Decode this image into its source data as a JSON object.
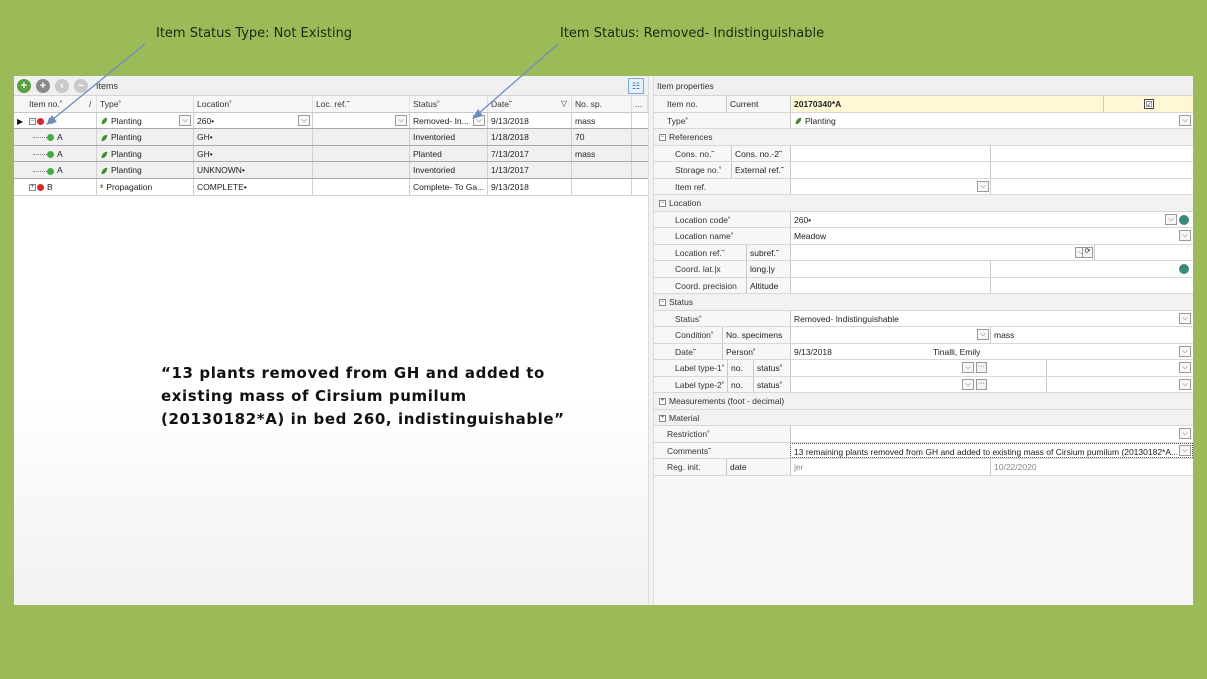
{
  "callouts": {
    "left": "Item Status Type: Not Existing",
    "right": "Item Status: Removed- Indistinguishable"
  },
  "quote": "“13 plants removed from GH and added to existing mass of Cirsium pumilum (20130182*A) in bed 260, indistinguishable”",
  "items_pane": {
    "title": "Items",
    "toolbar_icons": [
      "add-icon",
      "add-child-icon",
      "back-icon",
      "remove-icon",
      "tree-view-icon"
    ],
    "columns": [
      "Item no.˚",
      "Type˚",
      "Location˚",
      "Loc. ref.˜",
      "Status˚",
      "Date˜",
      "No. sp.",
      "..."
    ],
    "header_slash": "/",
    "rows": [
      {
        "no": "A",
        "type": "Planting",
        "location": "260•",
        "locref": "",
        "status": "Removed- In...",
        "date": "9/13/2018",
        "nsp": "mass"
      },
      {
        "no": "A",
        "type": "Planting",
        "location": "GH•",
        "locref": "",
        "status": "Inventoried",
        "date": "1/18/2018",
        "nsp": "70"
      },
      {
        "no": "A",
        "type": "Planting",
        "location": "GH•",
        "locref": "",
        "status": "Planted",
        "date": "7/13/2017",
        "nsp": "mass"
      },
      {
        "no": "A",
        "type": "Planting",
        "location": "UNKNOWN•",
        "locref": "",
        "status": "Inventoried",
        "date": "1/13/2017",
        "nsp": ""
      },
      {
        "no": "B",
        "type": "Propagation",
        "location": "COMPLETE•",
        "locref": "",
        "status": "Complete- To Ga...",
        "date": "9/13/2018",
        "nsp": ""
      }
    ],
    "colors": {
      "removed": "#d62a2a",
      "active": "#3fae3f",
      "leaf": "#3c8f2c"
    }
  },
  "props": {
    "title": "Item properties",
    "item_no_label": "Item no.",
    "current_label": "Current",
    "item_no_value": "20170340*A",
    "type_label": "Type˚",
    "type_value": "Planting",
    "references": {
      "section": "References",
      "cons_no": "Cons. no.˜",
      "cons_no2": "Cons. no.-2˜",
      "storage_no": "Storage no.˚",
      "external_ref": "External ref.˜",
      "item_ref": "Item ref."
    },
    "location": {
      "section": "Location",
      "code_label": "Location code˚",
      "code_value": "260•",
      "name_label": "Location name˚",
      "name_value": "Meadow",
      "ref_label": "Location ref.˜",
      "subref_label": "subref.˜",
      "coord_lat": "Coord. lat.|x",
      "coord_long": "long.|y",
      "precision": "Coord. precision",
      "altitude": "Altitude"
    },
    "status": {
      "section": "Status",
      "status_label": "Status˚",
      "status_value": "Removed- Indistinguishable",
      "condition_label": "Condition˚",
      "specimens_label": "No. specimens",
      "specimens_value": "mass",
      "date_label": "Date˜",
      "person_label": "Person˚",
      "date_value": "9/13/2018",
      "person_value": "Tinalli, Emily",
      "label1": "Label type-1˚",
      "label2": "Label type-2˚",
      "no_label": "no.",
      "status_small": "status˚"
    },
    "measurements": "Measurements (foot - decimal)",
    "material": "Material",
    "restriction_label": "Restriction˚",
    "comments_label": "Comments˜",
    "comments_value": "13 remaining plants removed from GH and added to existing mass of Cirsium pumilum (20130182*A...",
    "reg_init_label": "Reg. init.",
    "date_small": "date",
    "reg_init_value": "jer",
    "reg_date_value": "10/22/2020"
  }
}
